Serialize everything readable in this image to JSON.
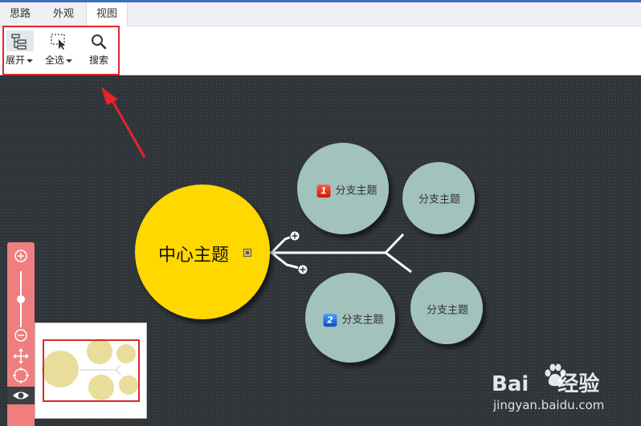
{
  "tabs": [
    {
      "label": "思路",
      "active": false
    },
    {
      "label": "外观",
      "active": false
    },
    {
      "label": "视图",
      "active": true
    }
  ],
  "toolbar": {
    "expand": {
      "label": "展开",
      "icon": "outline-tree-icon"
    },
    "select_all": {
      "label": "全选",
      "icon": "select-cursor-icon"
    },
    "search": {
      "label": "搜索",
      "icon": "magnifier-icon"
    }
  },
  "mindmap": {
    "central_topic": "中心主题",
    "central_color": "#ffd800",
    "branch_color": "#a2c2bc",
    "branches": [
      {
        "label": "分支主题",
        "marker": "1",
        "marker_color": "red"
      },
      {
        "label": "分支主题",
        "marker": "",
        "marker_color": ""
      },
      {
        "label": "分支主题",
        "marker": "2",
        "marker_color": "blue"
      },
      {
        "label": "分支主题",
        "marker": "",
        "marker_color": ""
      }
    ]
  },
  "zoom_panel": {
    "icons": [
      "zoom-in-icon",
      "zoom-out-icon",
      "move-icon",
      "fit-icon",
      "eye-icon"
    ],
    "zoom_level": 0.5
  },
  "watermark": {
    "line1": "Bai经验",
    "line2": "jingyan.baidu.com"
  },
  "colors": {
    "accent": "#3f6fb6",
    "highlight_red": "#e4242b",
    "canvas_bg": "#2f3439",
    "zoom_panel": "#f07e7e"
  }
}
